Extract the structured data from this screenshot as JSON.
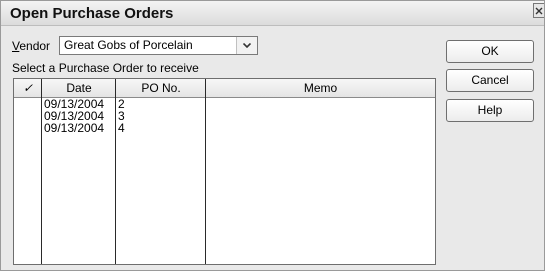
{
  "window": {
    "title": "Open Purchase Orders"
  },
  "vendor": {
    "label_underlined": "V",
    "label_rest": "endor",
    "value": "Great Gobs of Porcelain"
  },
  "instruction": "Select a Purchase Order to receive",
  "table": {
    "columns": {
      "check": "✓",
      "date": "Date",
      "po": "PO No.",
      "memo": "Memo"
    },
    "rows": [
      {
        "date": "09/13/2004",
        "po": "2",
        "memo": ""
      },
      {
        "date": "09/13/2004",
        "po": "3",
        "memo": ""
      },
      {
        "date": "09/13/2004",
        "po": "4",
        "memo": ""
      }
    ]
  },
  "buttons": {
    "ok": "OK",
    "cancel": "Cancel",
    "help": "Help"
  },
  "icons": {
    "close": "close-icon",
    "dropdown": "chevron-down-icon"
  }
}
